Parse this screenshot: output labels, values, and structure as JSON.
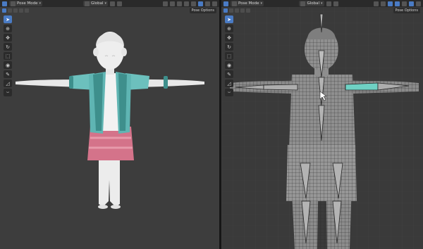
{
  "left": {
    "mode": "Pose Mode",
    "transform": "Global",
    "options": "Pose Options"
  },
  "right": {
    "mode": "Pose Mode",
    "transform": "Global",
    "options": "Pose Options"
  },
  "tools": [
    "select-tool",
    "cursor-tool",
    "move-tool",
    "rotate-tool",
    "scale-tool",
    "transform-tool",
    "annotate-tool",
    "measure-tool",
    "relax-tool"
  ],
  "colors": {
    "viewport_left": "#3d3d3d",
    "viewport_right": "#3a3a3a",
    "header": "#2a2a2a",
    "accent": "#4a7bc4",
    "jacket": "#5fb5b3",
    "skirt": "#d4738a",
    "skin": "#eeeeee",
    "bone_highlight": "#6fd1c4"
  }
}
